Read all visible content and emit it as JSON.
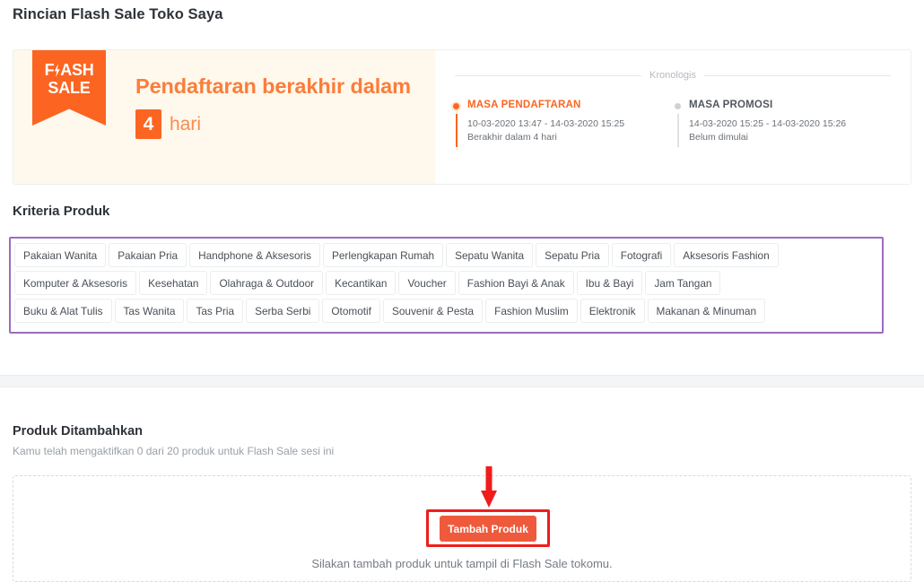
{
  "page": {
    "title": "Rincian Flash Sale Toko Saya"
  },
  "countdown": {
    "badge_line1_a": "F",
    "badge_line1_b": "ASH",
    "badge_line2": "SALE",
    "headline": "Pendaftaran berakhir dalam",
    "days_number": "4",
    "days_unit": "hari"
  },
  "chronology": {
    "divider_label": "Kronologis",
    "items": [
      {
        "title": "MASA PENDAFTARAN",
        "range": "10-03-2020 13:47 - 14-03-2020 15:25",
        "note": "Berakhir dalam 4 hari",
        "state": "active"
      },
      {
        "title": "MASA PROMOSI",
        "range": "14-03-2020 15:25 - 14-03-2020 15:26",
        "note": "Belum dimulai",
        "state": "inactive"
      }
    ]
  },
  "criteria": {
    "heading": "Kriteria Produk",
    "rows": [
      [
        "Pakaian Wanita",
        "Pakaian Pria",
        "Handphone & Aksesoris",
        "Perlengkapan Rumah",
        "Sepatu Wanita",
        "Sepatu Pria",
        "Fotografi",
        "Aksesoris Fashion"
      ],
      [
        "Komputer & Aksesoris",
        "Kesehatan",
        "Olahraga & Outdoor",
        "Kecantikan",
        "Voucher",
        "Fashion Bayi & Anak",
        "Ibu & Bayi",
        "Jam Tangan"
      ],
      [
        "Buku & Alat Tulis",
        "Tas Wanita",
        "Tas Pria",
        "Serba Serbi",
        "Otomotif",
        "Souvenir & Pesta",
        "Fashion Muslim",
        "Elektronik",
        "Makanan & Minuman"
      ]
    ]
  },
  "added_products": {
    "heading": "Produk Ditambahkan",
    "subtitle": "Kamu telah mengaktifkan 0 dari 20 produk untuk Flash Sale sesi ini",
    "add_button_label": "Tambah Produk",
    "empty_caption": "Silakan tambah produk untuk tampil di Flash Sale tokomu."
  },
  "colors": {
    "brand_orange": "#fb6521",
    "headline_orange": "#fb7d3a",
    "cream_bg": "#fff8ec",
    "annotation_red": "#f01c1c",
    "annotation_purple": "#9b6cc0",
    "button_red": "#ef5a3c"
  }
}
